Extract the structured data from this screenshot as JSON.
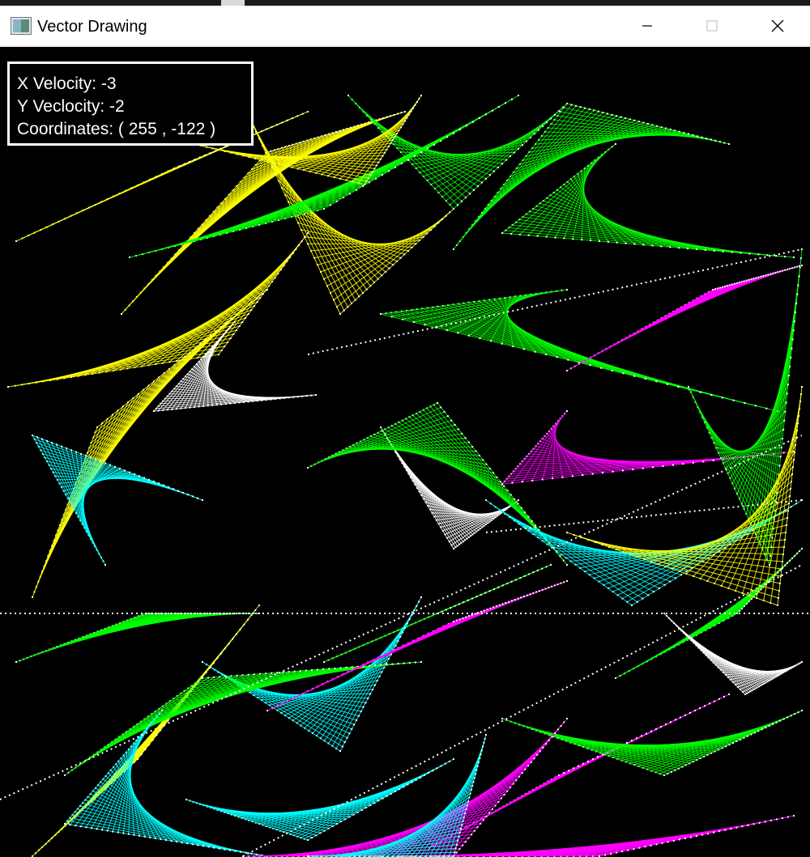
{
  "window": {
    "title": "Vector Drawing",
    "app_icon": "window-app-icon",
    "controls": {
      "minimize_icon": "minimize-icon",
      "maximize_icon": "maximize-icon",
      "close_icon": "close-icon"
    }
  },
  "hud": {
    "x_velocity": "X Velocity: -3",
    "y_velocity": "Y Veclocity: -2",
    "coordinates": "Coordinates: ( 255 , -122 )"
  },
  "palette": {
    "background": "#000000",
    "colors": [
      "#ffff00",
      "#00ff00",
      "#00ffff",
      "#ff00ff",
      "#ffffff"
    ]
  }
}
